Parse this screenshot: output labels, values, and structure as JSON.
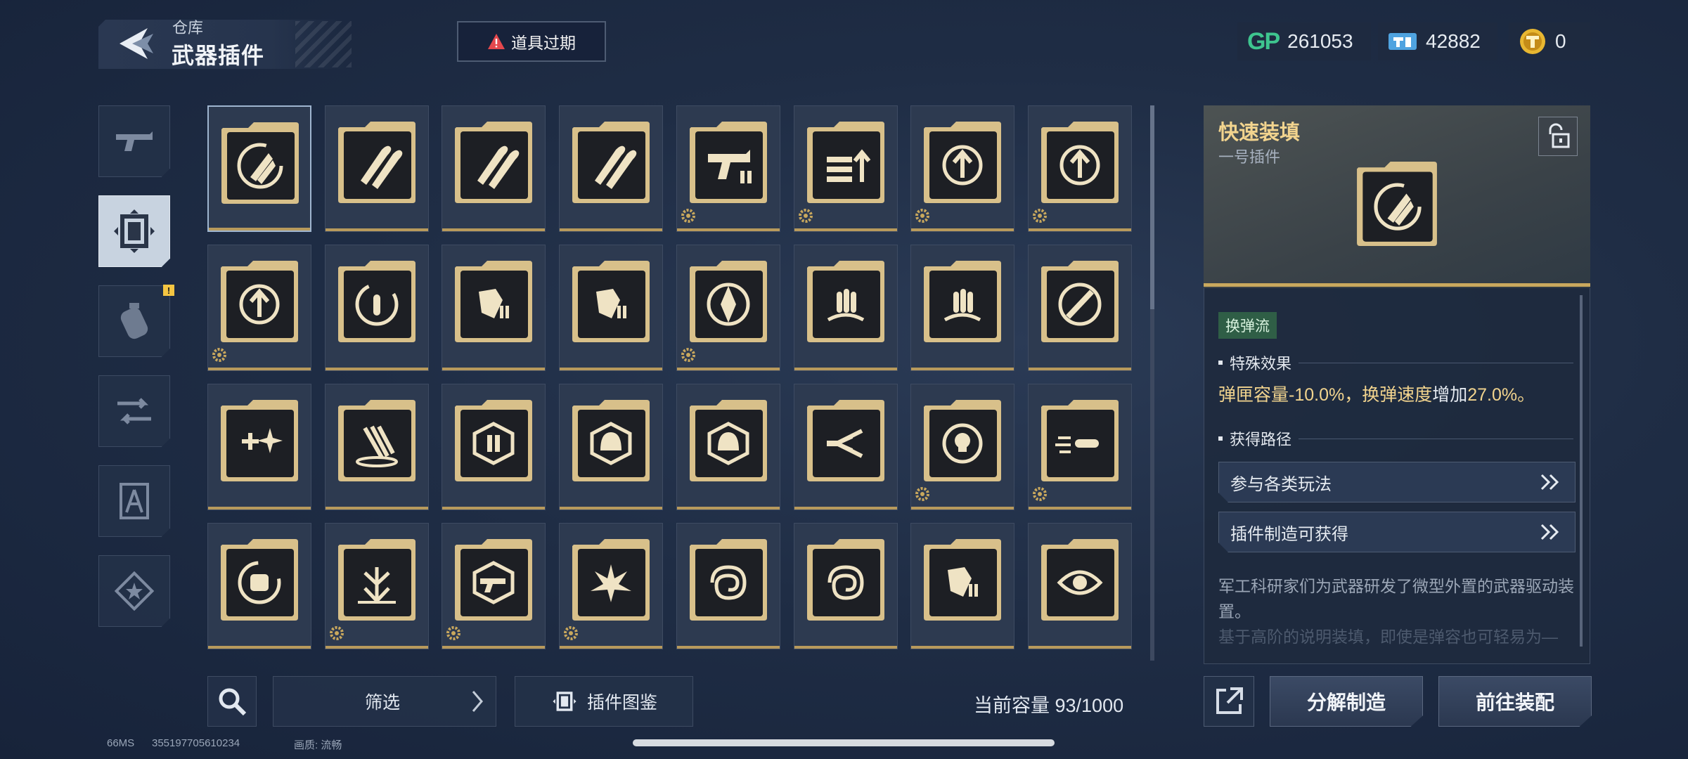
{
  "header": {
    "breadcrumb": "仓库",
    "title": "武器插件",
    "alert": "道具过期"
  },
  "currencies": [
    {
      "icon": "gp-currency-icon",
      "mark": "GP",
      "value": "261053"
    },
    {
      "icon": "ticket-currency-icon",
      "value": "42882"
    },
    {
      "icon": "gold-token-icon",
      "value": "0"
    }
  ],
  "sidebar": {
    "tabs": [
      {
        "icon": "gun-icon",
        "active": false
      },
      {
        "icon": "plugin-chip-icon",
        "active": true
      },
      {
        "icon": "grenade-icon",
        "active": false,
        "badge": "!"
      },
      {
        "icon": "weapon-swap-icon",
        "active": false
      },
      {
        "icon": "compass-tool-icon",
        "active": false
      },
      {
        "icon": "star-badge-icon",
        "active": false
      }
    ]
  },
  "grid": {
    "selected_index": 0,
    "items": [
      {
        "icon": "reload-rockets-icon",
        "gear": false
      },
      {
        "icon": "twin-bullets-icon",
        "gear": false
      },
      {
        "icon": "twin-bullets-icon",
        "gear": false
      },
      {
        "icon": "twin-bullets-icon",
        "gear": false
      },
      {
        "icon": "gun-ammo-icon",
        "gear": true
      },
      {
        "icon": "ammo-up-icon",
        "gear": true
      },
      {
        "icon": "crosshair-up-icon",
        "gear": true
      },
      {
        "icon": "crosshair-up-icon",
        "gear": true
      },
      {
        "icon": "crosshair-up-icon",
        "gear": true
      },
      {
        "icon": "bullet-cycle-icon",
        "gear": false
      },
      {
        "icon": "shatter-ammo-icon",
        "gear": false
      },
      {
        "icon": "shatter-ammo-icon",
        "gear": false
      },
      {
        "icon": "diamond-target-icon",
        "gear": true
      },
      {
        "icon": "bullet-crown-icon",
        "gear": false
      },
      {
        "icon": "bullet-crown-icon",
        "gear": false
      },
      {
        "icon": "no-rocket-icon",
        "gear": false
      },
      {
        "icon": "medkit-sparkle-icon",
        "gear": false
      },
      {
        "icon": "claw-splash-icon",
        "gear": false
      },
      {
        "icon": "ammo-rotate-icon",
        "gear": false
      },
      {
        "icon": "helmet-hex-icon",
        "gear": false
      },
      {
        "icon": "helmet-hex-icon",
        "gear": false
      },
      {
        "icon": "dash-arrows-icon",
        "gear": false
      },
      {
        "icon": "skull-target-icon",
        "gear": true
      },
      {
        "icon": "bullet-speed-icon",
        "gear": true
      },
      {
        "icon": "fist-cycle-icon",
        "gear": false
      },
      {
        "icon": "down-burst-icon",
        "gear": true
      },
      {
        "icon": "gun-hex-icon",
        "gear": true
      },
      {
        "icon": "explosion-icon",
        "gear": true
      },
      {
        "icon": "vortex-icon",
        "gear": false
      },
      {
        "icon": "vortex-icon",
        "gear": false
      },
      {
        "icon": "shatter-ammo-icon",
        "gear": false
      },
      {
        "icon": "eye-icon",
        "gear": false
      }
    ]
  },
  "bottom": {
    "filter_label": "筛选",
    "catalog_label": "插件图鉴",
    "capacity": "当前容量 93/1000"
  },
  "footer": {
    "latency": "66MS",
    "uid": "355197705610234",
    "quality": "画质: 流畅"
  },
  "detail": {
    "name": "快速装填",
    "slot": "一号插件",
    "tag": "换弹流",
    "effect_heading": "特殊效果",
    "effect_parts": [
      "弹匣容量-10.0%，换弹速度",
      "增加",
      "27.0%。"
    ],
    "route_heading": "获得路径",
    "routes": [
      "参与各类玩法",
      "插件制造可获得"
    ],
    "description": "军工科研家们为武器研发了微型外置的武器驱动装置。",
    "description_faded": "基于高阶的说明装填，即使是弹容也可轻易为—",
    "actions": [
      "分解制造",
      "前往装配"
    ]
  },
  "colors": {
    "accent_gold": "#c9a85d",
    "title_gold": "#f2d48e",
    "tag_green": "#2f5e46",
    "gp_green": "#3ec58f"
  }
}
